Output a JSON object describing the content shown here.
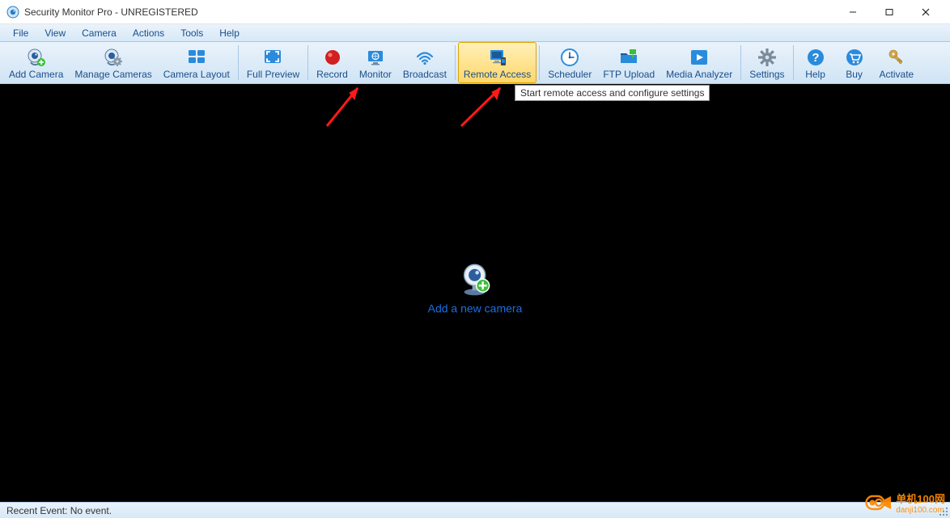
{
  "window": {
    "title": "Security Monitor Pro - UNREGISTERED"
  },
  "menu": {
    "items": [
      "File",
      "View",
      "Camera",
      "Actions",
      "Tools",
      "Help"
    ]
  },
  "toolbar": {
    "groups": [
      [
        "Add Camera",
        "Manage Cameras",
        "Camera Layout"
      ],
      [
        "Full Preview"
      ],
      [
        "Record",
        "Monitor",
        "Broadcast"
      ],
      [
        "Remote Access"
      ],
      [
        "Scheduler",
        "FTP Upload",
        "Media Analyzer"
      ],
      [
        "Settings"
      ],
      [
        "Help",
        "Buy",
        "Activate"
      ]
    ],
    "selected": "Remote Access"
  },
  "tooltip": {
    "text": "Start remote access and configure settings"
  },
  "main": {
    "add_camera_label": "Add a new camera"
  },
  "status": {
    "recent_event": "Recent Event: No event."
  },
  "watermark": {
    "text": "单机100网",
    "sub": "danji100.com"
  }
}
